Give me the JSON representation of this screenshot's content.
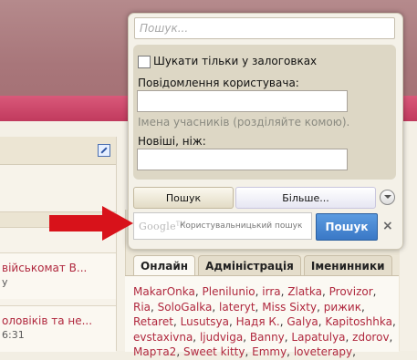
{
  "popup": {
    "search_placeholder": "Пошук...",
    "titles_only_label": "Шукати тільки у залоговках",
    "member_posts_label": "Повідомлення користувача:",
    "member_hint": "Імена учасників (розділяйте комою).",
    "newer_than_label": "Новіші, ніж:",
    "search_button": "Пошук",
    "more_button": "Більше...",
    "google_logo": "Google",
    "google_placeholder": "Користувальницький пошук",
    "go_button": "Пошук",
    "close_symbol": "×"
  },
  "sidebar": {
    "tabs": [
      "Онлайн",
      "Адміністрація",
      "Іменинники"
    ],
    "names": [
      "MakarOnka",
      "Plenilunio",
      "irra",
      "Zlatka",
      "Provizor",
      "Ria",
      "SoloGalka",
      "lateryt",
      "Miss Sixty",
      "рижик",
      "Retaret",
      "Lusutsya",
      "Надя К.",
      "Galya",
      "Kapitoshhka",
      "evstaxivna",
      "ljudviga",
      "Banny",
      "Lapatulya",
      "zdorov",
      "Марта2",
      "Sweet kitty",
      "Emmy",
      "loveterapy"
    ]
  },
  "threads": [
    {
      "title": "військомат В...",
      "meta": "у"
    },
    {
      "title": "оловіків та не...",
      "meta": "6:31"
    }
  ],
  "colors": {
    "accent_link": "#b0283e",
    "go_button": "#3a78c6",
    "arrow": "#d8121a"
  }
}
